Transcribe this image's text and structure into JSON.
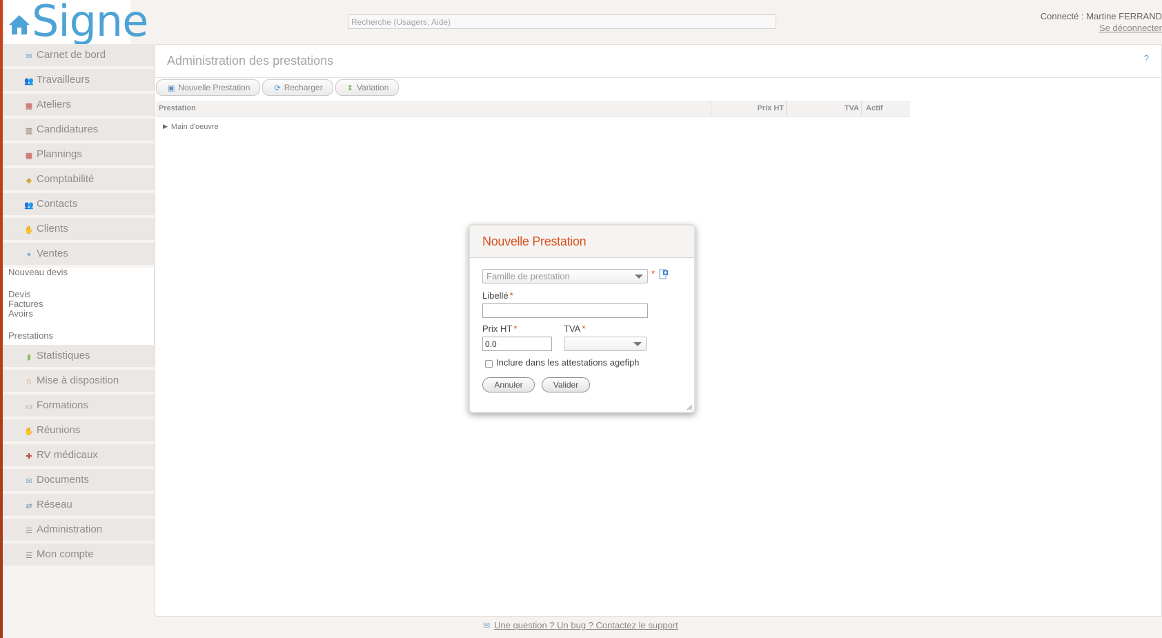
{
  "header": {
    "logo_text": "Signe",
    "search_placeholder": "Recherche (Usagers, Aide)",
    "user_label": "Connecté : Martine FERRAND",
    "logout_label": "Se déconnecter"
  },
  "sidebar": {
    "items": [
      {
        "label": "Carnet de bord",
        "icon": "envelope-icon",
        "glyph": "✉",
        "color": "#7aa7c7"
      },
      {
        "label": "Travailleurs",
        "icon": "users-icon",
        "glyph": "👥",
        "color": "#6a8fb3"
      },
      {
        "label": "Ateliers",
        "icon": "calendar-icon",
        "glyph": "▦",
        "color": "#c0504d"
      },
      {
        "label": "Candidatures",
        "icon": "cabinet-icon",
        "glyph": "▥",
        "color": "#8a7a5a"
      },
      {
        "label": "Plannings",
        "icon": "calendar-icon",
        "glyph": "▦",
        "color": "#c0504d"
      },
      {
        "label": "Comptabilité",
        "icon": "coins-icon",
        "glyph": "◆",
        "color": "#d6a93a"
      },
      {
        "label": "Contacts",
        "icon": "users-icon",
        "glyph": "👥",
        "color": "#6a8fb3"
      },
      {
        "label": "Clients",
        "icon": "handshake-icon",
        "glyph": "✋",
        "color": "#c08a5a"
      },
      {
        "label": "Ventes",
        "icon": "globe-icon",
        "glyph": "●",
        "color": "#8ab0d0"
      }
    ],
    "submenu": [
      "Nouveau devis",
      "Devis",
      "Factures",
      "Avoirs",
      "Prestations"
    ],
    "items_after": [
      {
        "label": "Statistiques",
        "icon": "bar-chart-icon",
        "glyph": "▮",
        "color": "#8cbf5a"
      },
      {
        "label": "Mise à disposition",
        "icon": "house-icon",
        "glyph": "⌂",
        "color": "#c08a5a"
      },
      {
        "label": "Formations",
        "icon": "board-icon",
        "glyph": "▭",
        "color": "#8aa070"
      },
      {
        "label": "Réunions",
        "icon": "handshake-icon",
        "glyph": "✋",
        "color": "#c08a5a"
      },
      {
        "label": "RV médicaux",
        "icon": "medical-icon",
        "glyph": "✚",
        "color": "#c0504d"
      },
      {
        "label": "Documents",
        "icon": "envelope-icon",
        "glyph": "✉",
        "color": "#7aa7c7"
      },
      {
        "label": "Réseau",
        "icon": "network-icon",
        "glyph": "⇄",
        "color": "#7a8fa8"
      },
      {
        "label": "Administration",
        "icon": "settings-list-icon",
        "glyph": "☰",
        "color": "#8a8a8a"
      },
      {
        "label": "Mon compte",
        "icon": "settings-list-icon",
        "glyph": "☰",
        "color": "#8a8a8a"
      }
    ]
  },
  "main": {
    "title": "Administration des prestations",
    "help": "?",
    "toolbar": [
      {
        "label": "Nouvelle Prestation",
        "icon": "new-document-icon",
        "glyph": "▣",
        "color": "#5a8fc7"
      },
      {
        "label": "Recharger",
        "icon": "reload-icon",
        "glyph": "⟳",
        "color": "#3a8fd6"
      },
      {
        "label": "Variation",
        "icon": "up-down-arrow-icon",
        "glyph": "⇕",
        "color": "#5aa03a"
      }
    ],
    "grid": {
      "columns": [
        "Prestation",
        "Prix HT",
        "TVA",
        "Actif"
      ],
      "rows": [
        {
          "label": "Main d'oeuvre"
        }
      ]
    }
  },
  "dialog": {
    "title": "Nouvelle Prestation",
    "famille_placeholder": "Famille de prestation",
    "libelle_label": "Libellé",
    "prix_label": "Prix HT",
    "prix_value": "0.0",
    "tva_label": "TVA",
    "tva_value": "",
    "required_mark": "*",
    "checkbox_label": "Inclure dans les attestations agefiph",
    "checkbox_checked": false,
    "cancel_label": "Annuler",
    "ok_label": "Valider"
  },
  "footer": {
    "support_link": "Une question ? Un bug ? Contactez le support"
  }
}
